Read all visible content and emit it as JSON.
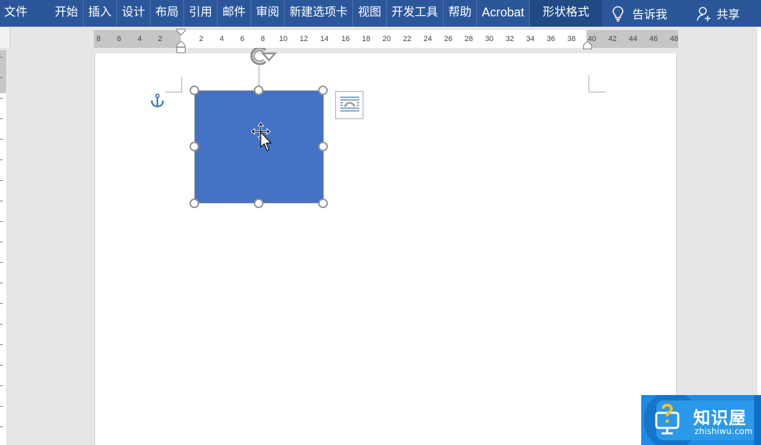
{
  "ribbon": {
    "tabs": [
      {
        "label": "文件"
      },
      {
        "label": "开始"
      },
      {
        "label": "插入"
      },
      {
        "label": "设计"
      },
      {
        "label": "布局"
      },
      {
        "label": "引用"
      },
      {
        "label": "邮件"
      },
      {
        "label": "审阅"
      },
      {
        "label": "新建选项卡"
      },
      {
        "label": "视图"
      },
      {
        "label": "开发工具"
      },
      {
        "label": "帮助"
      },
      {
        "label": "Acrobat"
      }
    ],
    "context_tab": {
      "label": "形状格式"
    },
    "tell_me": {
      "label": "告诉我",
      "icon": "lightbulb-icon"
    },
    "share": {
      "label": "共享",
      "icon": "person-add-icon"
    },
    "colors": {
      "bar": "#2b579a",
      "context": "#1f4a84"
    }
  },
  "ruler": {
    "left_ticks": [
      "8",
      "6",
      "4",
      "2"
    ],
    "right_ticks": [
      "2",
      "4",
      "6",
      "8",
      "10",
      "12",
      "14",
      "16",
      "18",
      "20",
      "22",
      "24",
      "26",
      "28",
      "30",
      "32",
      "34",
      "36",
      "38",
      "40",
      "42",
      "44",
      "46",
      "48"
    ]
  },
  "document": {
    "shape": {
      "type": "rectangle",
      "fill": "#4472c4",
      "selected": true
    },
    "anchor_icon": "anchor-icon",
    "layout_options_icon": "layout-options-icon",
    "rotation_handle_icon": "rotate-icon",
    "cursor_icon": "move-cursor-icon"
  },
  "watermark": {
    "title": "知识屋",
    "url": "zhishiwu.com",
    "icon": "question-monitor-icon"
  }
}
